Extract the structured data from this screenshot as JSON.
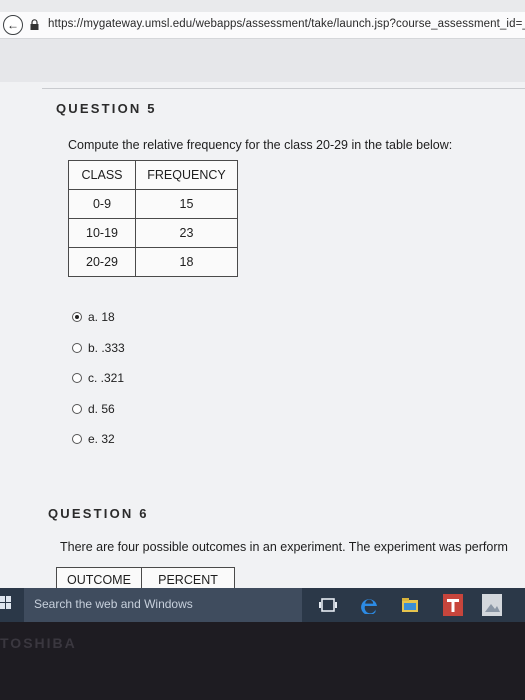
{
  "browser": {
    "url": "https://mygateway.umsl.edu/webapps/assessment/take/launch.jsp?course_assessment_id=_73"
  },
  "question5": {
    "heading": "QUESTION 5",
    "prompt": "Compute the relative frequency for the class 20-29 in the table below:",
    "table": {
      "headers": [
        "CLASS",
        "FREQUENCY"
      ],
      "rows": [
        [
          "0-9",
          "15"
        ],
        [
          "10-19",
          "23"
        ],
        [
          "20-29",
          "18"
        ]
      ]
    },
    "options": [
      {
        "label": "a. 18",
        "selected": true
      },
      {
        "label": "b. .333",
        "selected": false
      },
      {
        "label": "c. .321",
        "selected": false
      },
      {
        "label": "d. 56",
        "selected": false
      },
      {
        "label": "e. 32",
        "selected": false
      }
    ]
  },
  "question6": {
    "heading": "QUESTION 6",
    "prompt": "There are four possible outcomes in an experiment. The experiment was perform",
    "table_headers": [
      "OUTCOME",
      "PERCENT"
    ]
  },
  "taskbar": {
    "search_placeholder": "Search the web and Windows"
  },
  "device": {
    "brand": "TOSHIBA"
  }
}
